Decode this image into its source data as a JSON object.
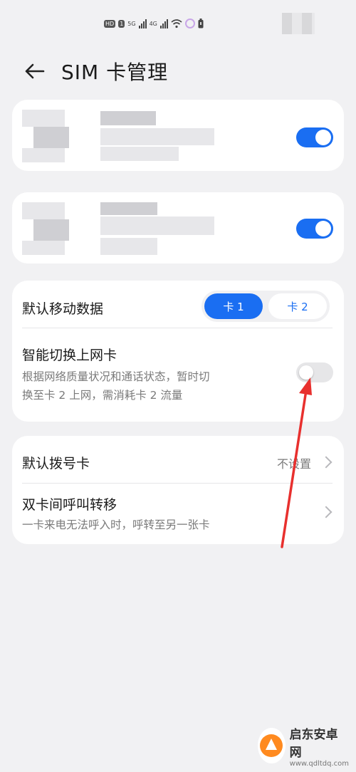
{
  "status_bar": {
    "badges": [
      "HD",
      "1"
    ],
    "signal1_label": "5G",
    "signal2_label": "4G"
  },
  "header": {
    "title": "SIM 卡管理"
  },
  "sim_cards": [
    {
      "enabled": true
    },
    {
      "enabled": true
    }
  ],
  "data_card": {
    "title": "默认移动数据",
    "options": [
      "卡 1",
      "卡 2"
    ],
    "selected": "卡 1"
  },
  "smart_switch": {
    "title": "智能切换上网卡",
    "description_line1": "根据网络质量状况和通话状态，暂时切",
    "description_line2": "换至卡 2 上网，需消耗卡 2 流量",
    "enabled": false
  },
  "default_dial": {
    "title": "默认拨号卡",
    "value": "不设置"
  },
  "call_forward": {
    "title": "双卡间呼叫转移",
    "description": "一卡来电无法呼入时，呼转至另一张卡"
  },
  "watermark": {
    "name": "启东安卓网",
    "url": "www.qdltdq.com"
  },
  "colors": {
    "accent": "#1a6ef2",
    "background": "#f1f1f3",
    "annotation_arrow": "#e8302e"
  },
  "icons": [
    "back-arrow-icon",
    "chevron-right-icon",
    "wifi-icon",
    "battery-icon",
    "signal-icon"
  ]
}
